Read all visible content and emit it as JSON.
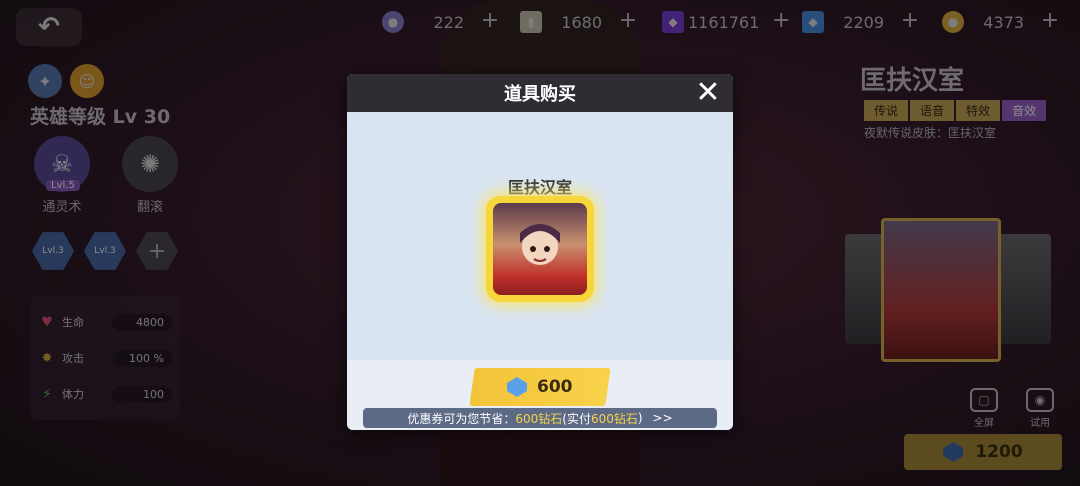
{
  "topbar": {
    "resources": [
      {
        "icon": "purple-orb-icon",
        "value": "222",
        "color": "#8a7fd0"
      },
      {
        "icon": "ticket-icon",
        "value": "1680",
        "color": "#c8c4b0"
      },
      {
        "icon": "purple-cube-icon",
        "value": "1161761",
        "color": "#7a3fd8"
      },
      {
        "icon": "blue-gem-icon",
        "value": "2209",
        "color": "#4a8ee0"
      },
      {
        "icon": "gold-coin-icon",
        "value": "4373",
        "color": "#e0b040"
      }
    ],
    "plus_label": "+"
  },
  "hero": {
    "level_text": "英雄等级 Lv 30",
    "skills": [
      {
        "name": "通灵术",
        "level": "Lvl.5"
      },
      {
        "name": "翻滚",
        "level": ""
      }
    ],
    "passives": [
      {
        "level": "Lvl.3"
      },
      {
        "level": "Lvl.3"
      },
      {
        "level": "+"
      }
    ],
    "stats": [
      {
        "icon": "heart-icon",
        "label": "生命",
        "value": "4800",
        "color": "#e05070"
      },
      {
        "icon": "attack-burst-icon",
        "label": "攻击",
        "value": "100 %",
        "color": "#e0b040"
      },
      {
        "icon": "lightning-icon",
        "label": "体力",
        "value": "100",
        "color": "#60d060"
      }
    ]
  },
  "skin_panel": {
    "title": "匡扶汉室",
    "tags": [
      "传说",
      "语音",
      "特效",
      "音效"
    ],
    "description": "夜默传说皮肤：匡扶汉室",
    "fullscreen_label": "全屏",
    "try_label": "试用",
    "price": "1200"
  },
  "modal": {
    "title": "道具购买",
    "item_name": "匡扶汉室",
    "price": "600",
    "coupon_prefix": "优惠券可为您节省：",
    "coupon_save": "600钻石",
    "coupon_mid": "(实付",
    "coupon_pay": "600钻石",
    "coupon_end": ")",
    "coupon_arrow": ">>"
  }
}
